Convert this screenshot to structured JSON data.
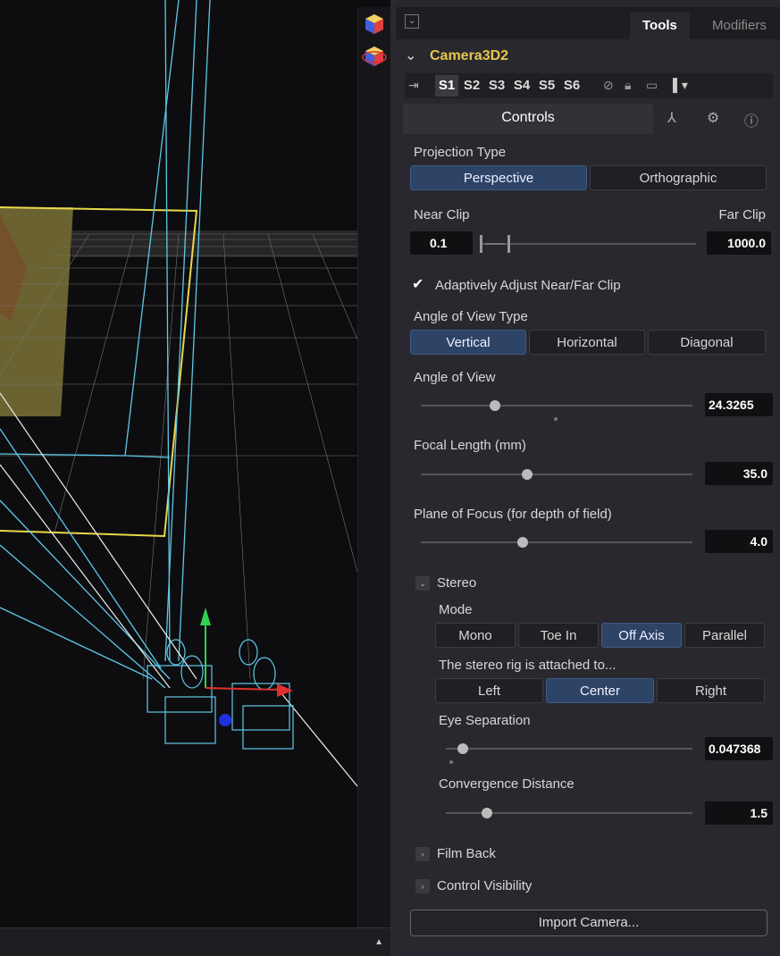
{
  "tabs": {
    "tools": "Tools",
    "modifiers": "Modifiers"
  },
  "node": {
    "name": "Camera3D2"
  },
  "view_sets": [
    "S1",
    "S2",
    "S3",
    "S4",
    "S5",
    "S6"
  ],
  "subtabs": {
    "controls": "Controls"
  },
  "projection": {
    "label": "Projection Type",
    "options": [
      "Perspective",
      "Orthographic"
    ],
    "selected": "Perspective"
  },
  "clip": {
    "near_label": "Near Clip",
    "far_label": "Far Clip",
    "near_value": "0.1",
    "far_value": "1000.0"
  },
  "adaptive": {
    "label": "Adaptively Adjust Near/Far Clip",
    "checked": true
  },
  "aov_type": {
    "label": "Angle of View Type",
    "options": [
      "Vertical",
      "Horizontal",
      "Diagonal"
    ],
    "selected": "Vertical"
  },
  "aov": {
    "label": "Angle of View",
    "value": "24.3265"
  },
  "focal": {
    "label": "Focal Length (mm)",
    "value": "35.0"
  },
  "focus": {
    "label": "Plane of Focus (for depth of field)",
    "value": "4.0"
  },
  "stereo": {
    "label": "Stereo",
    "mode_label": "Mode",
    "modes": [
      "Mono",
      "Toe In",
      "Off Axis",
      "Parallel"
    ],
    "mode_selected": "Off Axis",
    "rig_label": "The stereo rig is attached to...",
    "rig_options": [
      "Left",
      "Center",
      "Right"
    ],
    "rig_selected": "Center",
    "eye_sep_label": "Eye Separation",
    "eye_sep_value": "0.047368",
    "conv_label": "Convergence Distance",
    "conv_value": "1.5"
  },
  "sections": {
    "film_back": "Film Back",
    "control_visibility": "Control Visibility"
  },
  "import_button": "Import Camera..."
}
